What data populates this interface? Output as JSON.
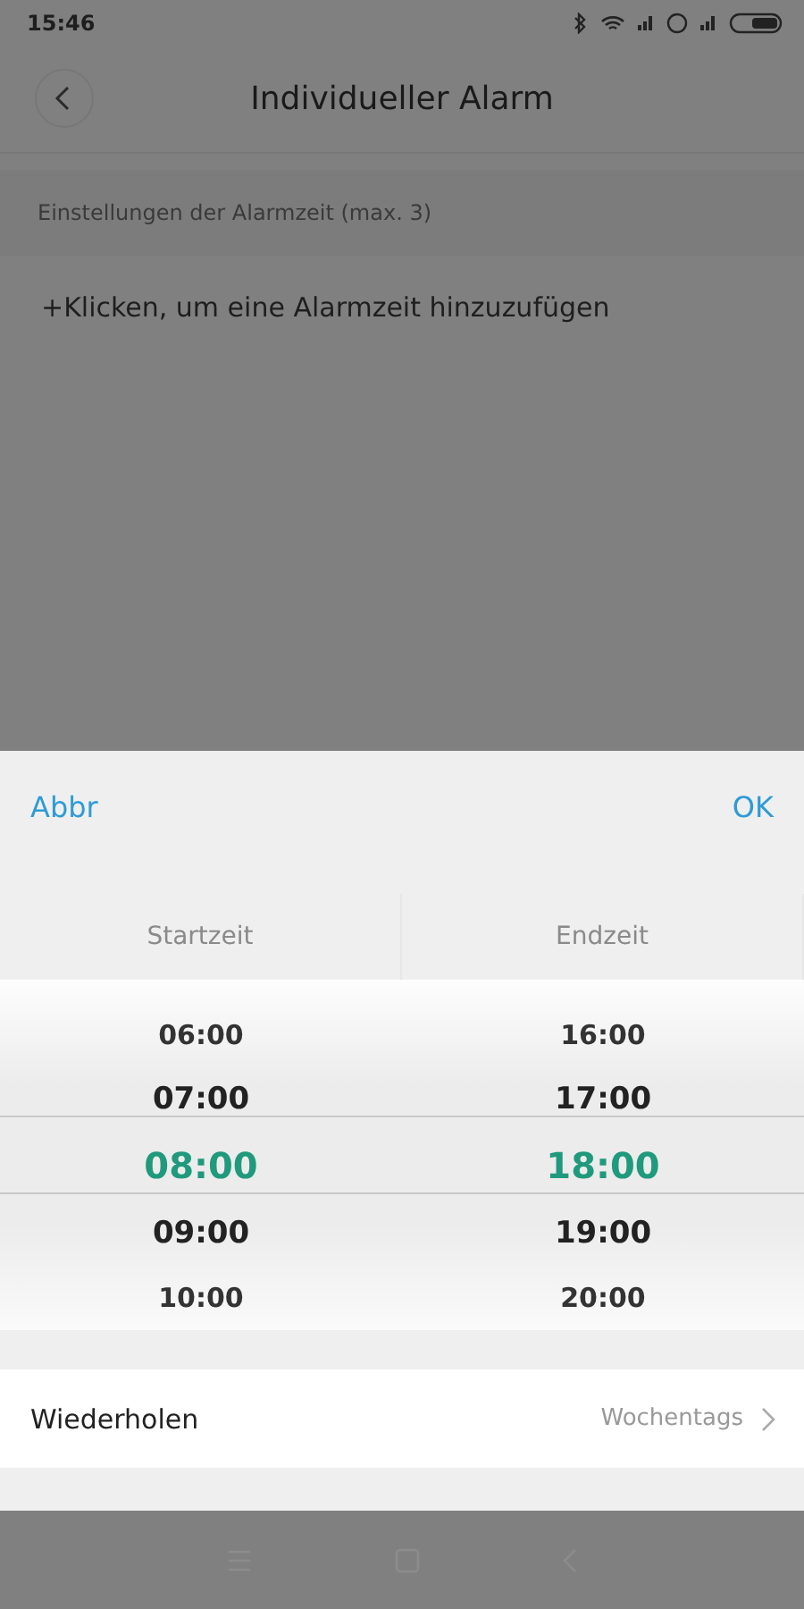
{
  "status_bar": {
    "time": "15:46"
  },
  "header": {
    "title": "Individueller Alarm"
  },
  "section_label": "Einstellungen der Alarmzeit (max. 3)",
  "add_row": "+Klicken, um eine Alarmzeit hinzuzufügen",
  "sheet": {
    "cancel": "Abbr",
    "ok": "OK",
    "columns": [
      {
        "heading": "Startzeit",
        "items": [
          {
            "label": "06:00",
            "selected": false
          },
          {
            "label": "07:00",
            "selected": false
          },
          {
            "label": "08:00",
            "selected": true
          },
          {
            "label": "09:00",
            "selected": false
          },
          {
            "label": "10:00",
            "selected": false
          }
        ]
      },
      {
        "heading": "Endzeit",
        "items": [
          {
            "label": "16:00",
            "selected": false
          },
          {
            "label": "17:00",
            "selected": false
          },
          {
            "label": "18:00",
            "selected": true
          },
          {
            "label": "19:00",
            "selected": false
          },
          {
            "label": "20:00",
            "selected": false
          }
        ]
      }
    ],
    "repeat": {
      "label": "Wiederholen",
      "value": "Wochentags"
    }
  }
}
